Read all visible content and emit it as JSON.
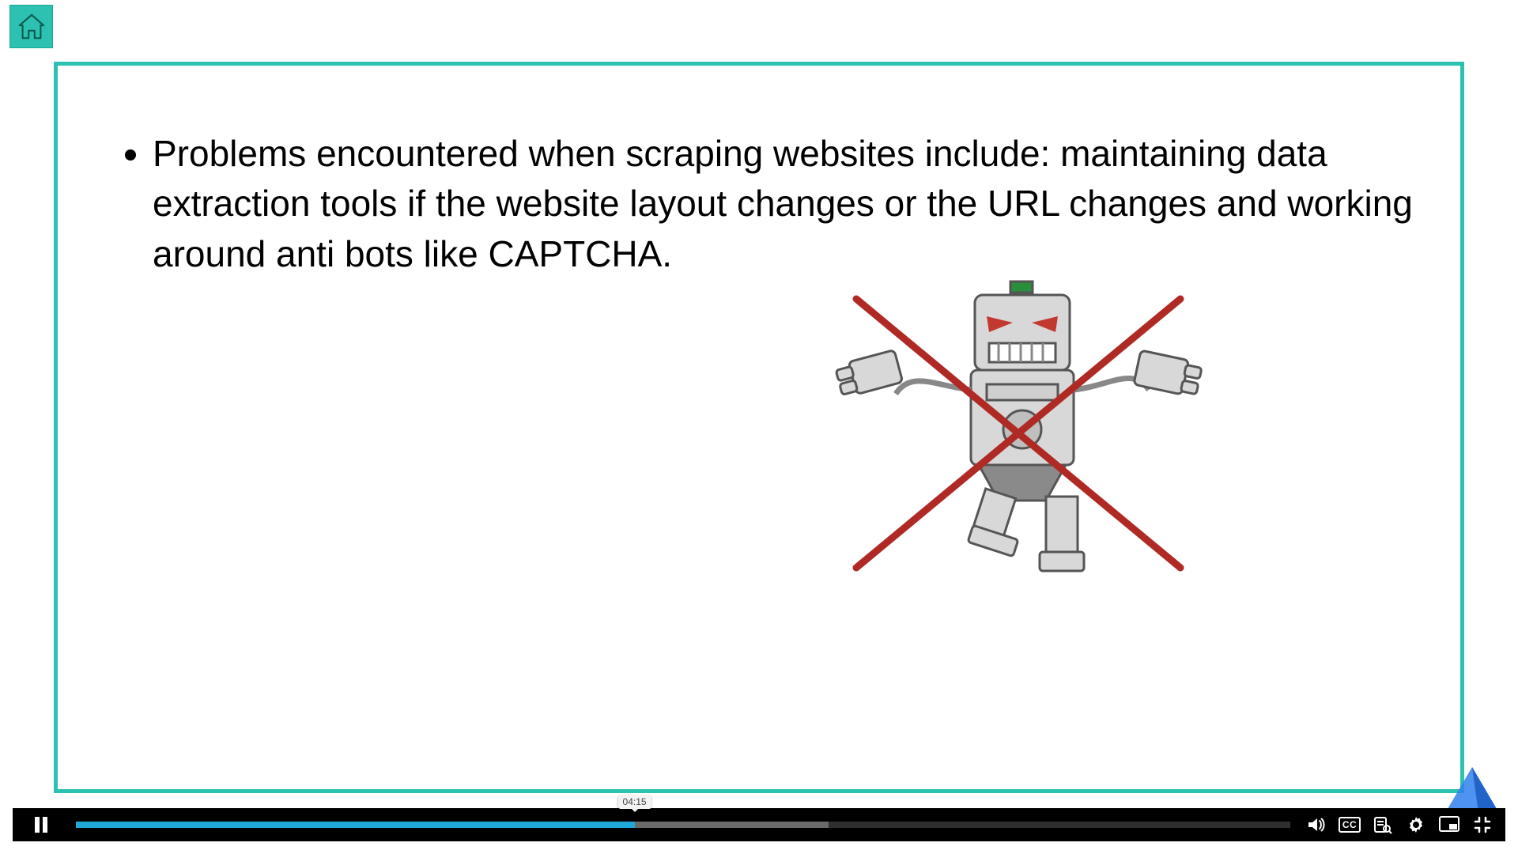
{
  "colors": {
    "accent": "#2cc1b0",
    "player_accent": "#1ea8d6"
  },
  "home": {
    "label": "Home"
  },
  "slide": {
    "bullets": [
      "Problems encountered when scraping websites include: maintaining data extraction tools if the website layout changes or the URL changes and working around anti bots like CAPTCHA."
    ],
    "image_alt": "Robot crossed out (anti-bot illustration)"
  },
  "player": {
    "state": "playing",
    "pause_label": "Pause",
    "time_tooltip": "04:15",
    "played_percent": 46,
    "buffered_percent": 62,
    "controls": {
      "volume": "Volume",
      "cc": "CC",
      "transcript": "Search transcript",
      "settings": "Settings",
      "pip": "Picture in picture",
      "fullscreen": "Exit fullscreen"
    }
  }
}
